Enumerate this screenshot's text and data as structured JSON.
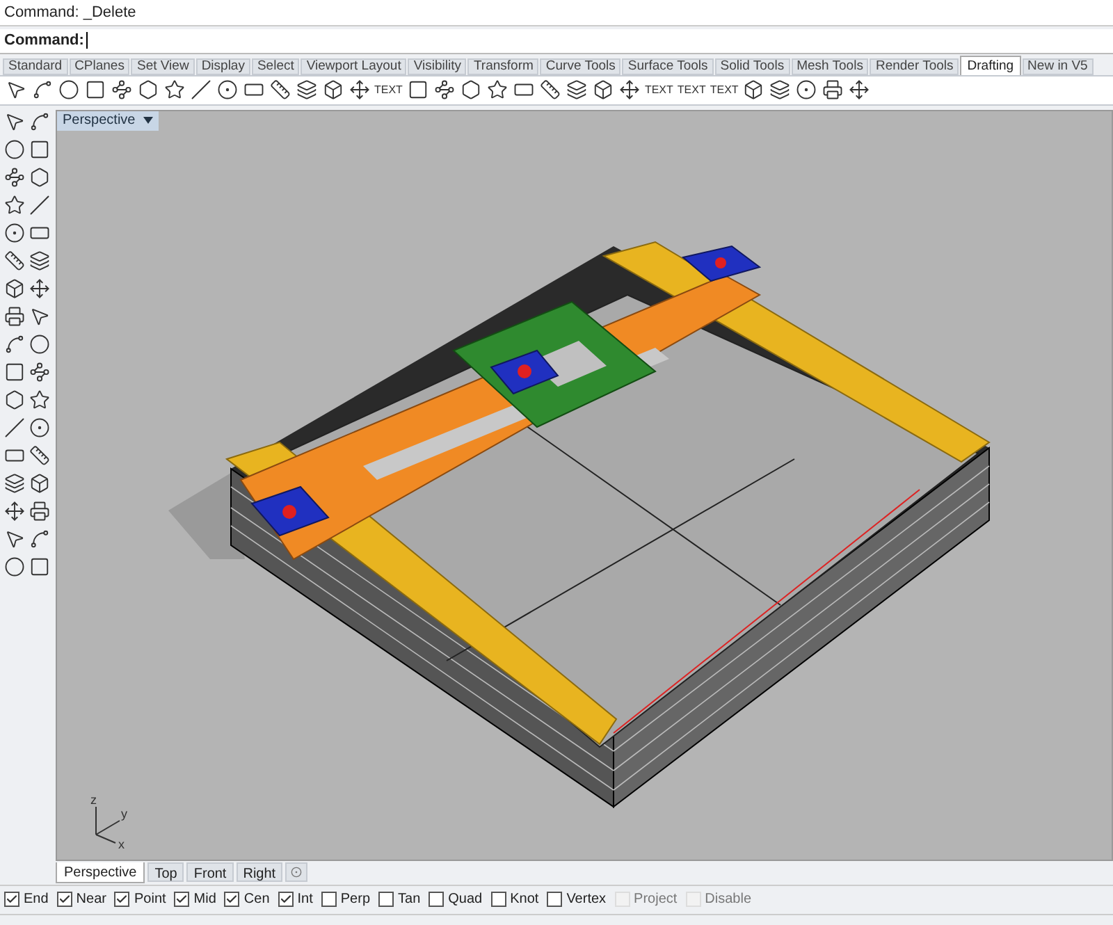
{
  "command_history": "Command: _Delete",
  "command_prompt": {
    "label": "Command:"
  },
  "toolbar_tabs": [
    {
      "label": "Standard",
      "selected": false
    },
    {
      "label": "CPlanes",
      "selected": false
    },
    {
      "label": "Set View",
      "selected": false
    },
    {
      "label": "Display",
      "selected": false
    },
    {
      "label": "Select",
      "selected": false
    },
    {
      "label": "Viewport Layout",
      "selected": false
    },
    {
      "label": "Visibility",
      "selected": false
    },
    {
      "label": "Transform",
      "selected": false
    },
    {
      "label": "Curve Tools",
      "selected": false
    },
    {
      "label": "Surface Tools",
      "selected": false
    },
    {
      "label": "Solid Tools",
      "selected": false
    },
    {
      "label": "Mesh Tools",
      "selected": false
    },
    {
      "label": "Render Tools",
      "selected": false
    },
    {
      "label": "Drafting",
      "selected": true
    },
    {
      "label": "New in V5",
      "selected": false
    }
  ],
  "toolbar_text_buttons": [
    "TEXT",
    "TEXT",
    "TEXT",
    "TEXT"
  ],
  "viewport": {
    "title": "Perspective",
    "axis_labels": [
      "z",
      "y",
      "x"
    ]
  },
  "viewport_tabs": [
    {
      "label": "Perspective",
      "selected": true
    },
    {
      "label": "Top",
      "selected": false
    },
    {
      "label": "Front",
      "selected": false
    },
    {
      "label": "Right",
      "selected": false
    }
  ],
  "osnaps": [
    {
      "label": "End",
      "checked": true,
      "disabled": false
    },
    {
      "label": "Near",
      "checked": true,
      "disabled": false
    },
    {
      "label": "Point",
      "checked": true,
      "disabled": false
    },
    {
      "label": "Mid",
      "checked": true,
      "disabled": false
    },
    {
      "label": "Cen",
      "checked": true,
      "disabled": false
    },
    {
      "label": "Int",
      "checked": true,
      "disabled": false
    },
    {
      "label": "Perp",
      "checked": false,
      "disabled": false
    },
    {
      "label": "Tan",
      "checked": false,
      "disabled": false
    },
    {
      "label": "Quad",
      "checked": false,
      "disabled": false
    },
    {
      "label": "Knot",
      "checked": false,
      "disabled": false
    },
    {
      "label": "Vertex",
      "checked": false,
      "disabled": false
    },
    {
      "label": "Project",
      "checked": false,
      "disabled": true
    },
    {
      "label": "Disable",
      "checked": false,
      "disabled": true
    }
  ]
}
